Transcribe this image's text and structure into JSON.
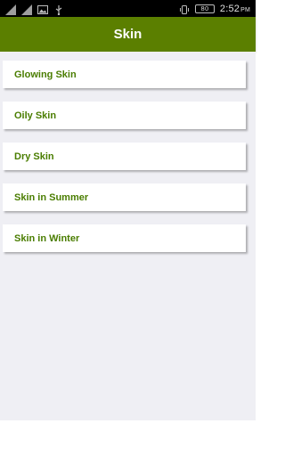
{
  "status_bar": {
    "icons_left": [
      "signal-icon",
      "signal-icon",
      "image-icon",
      "usb-icon"
    ],
    "icons_right": [
      "vibrate-icon",
      "battery-icon"
    ],
    "battery_text": "80",
    "time": "2:52",
    "ampm": "PM"
  },
  "app_bar": {
    "title": "Skin"
  },
  "list": {
    "items": [
      {
        "label": "Glowing Skin"
      },
      {
        "label": "Oily Skin"
      },
      {
        "label": "Dry Skin"
      },
      {
        "label": "Skin in Summer"
      },
      {
        "label": "Skin in Winter"
      }
    ]
  },
  "colors": {
    "app_bar": "#5b7f00",
    "item_text": "#4a7d00",
    "background": "#efeff4"
  }
}
